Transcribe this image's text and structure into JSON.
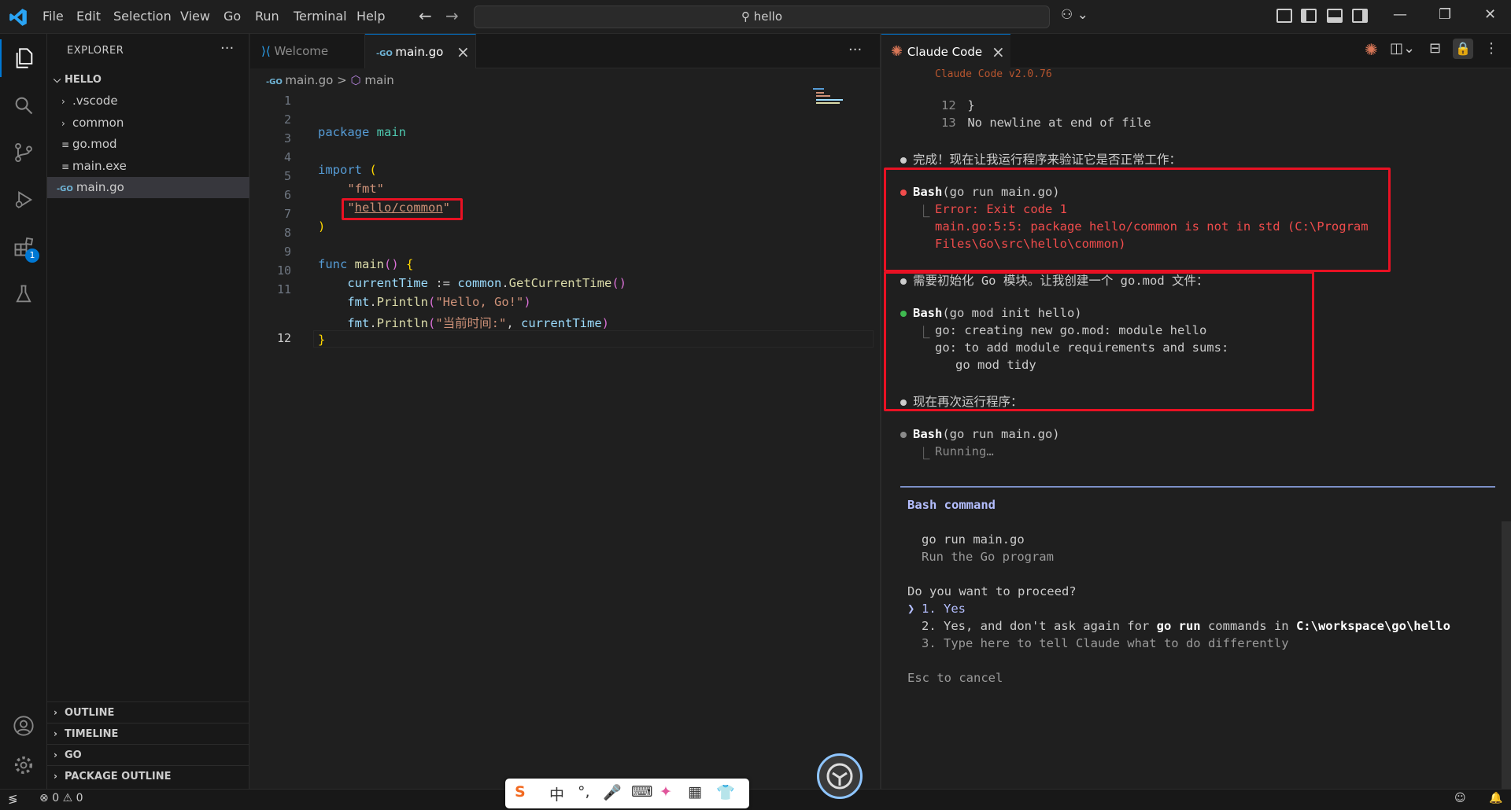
{
  "menu": {
    "items": [
      "File",
      "Edit",
      "Selection",
      "View",
      "Go",
      "Run",
      "Terminal",
      "Help"
    ]
  },
  "command_center": {
    "text": "hello",
    "icon": "search-icon"
  },
  "activity_bar": {
    "items": [
      {
        "name": "explorer",
        "icon": "files-icon",
        "active": true
      },
      {
        "name": "search",
        "icon": "search-icon"
      },
      {
        "name": "source-control",
        "icon": "source-control-icon"
      },
      {
        "name": "run-debug",
        "icon": "debug-icon"
      },
      {
        "name": "extensions",
        "icon": "extensions-icon",
        "badge": "1"
      },
      {
        "name": "testing",
        "icon": "flask-icon"
      }
    ],
    "bottom": [
      {
        "name": "accounts",
        "icon": "account-icon"
      },
      {
        "name": "manage",
        "icon": "gear-icon"
      }
    ]
  },
  "sidebar": {
    "title": "EXPLORER",
    "more": "···",
    "root": "HELLO",
    "items": [
      {
        "label": ".vscode",
        "type": "folder"
      },
      {
        "label": "common",
        "type": "folder"
      },
      {
        "label": "go.mod",
        "type": "file",
        "icon": "≡"
      },
      {
        "label": "main.exe",
        "type": "file",
        "icon": "≡"
      },
      {
        "label": "main.go",
        "type": "file",
        "icon": "-GO",
        "selected": true
      }
    ],
    "sections": [
      "OUTLINE",
      "TIMELINE",
      "GO",
      "PACKAGE OUTLINE"
    ]
  },
  "editor": {
    "tabs": [
      {
        "label": "Welcome",
        "active": false
      },
      {
        "label": "main.go",
        "active": true,
        "close": "×"
      }
    ],
    "more": "···",
    "breadcrumb": {
      "file": "main.go",
      "sep": ">",
      "symbol": "main"
    },
    "line_numbers": [
      "1",
      "2",
      "3",
      "4",
      "5",
      "6",
      "7",
      "8",
      "9",
      "10",
      "11",
      "12"
    ],
    "code": {
      "l1_kw": "package",
      "l1_name": "main",
      "l3_kw": "import",
      "l3_paren": "(",
      "l4": "\"fmt\"",
      "l5_q1": "\"",
      "l5_path": "hello/common",
      "l5_q2": "\"",
      "l6": ")",
      "l8_kw": "func",
      "l8_fn": "main",
      "l8_paren": "()",
      "l8_brace": "{",
      "l9_var": "currentTime",
      "l9_op": " := ",
      "l9_pkg": "common",
      "l9_dot": ".",
      "l9_fn": "GetCurrentTime",
      "l9_paren": "()",
      "l10_pkg": "fmt",
      "l10_dot": ".",
      "l10_fn": "Println",
      "l10_open": "(",
      "l10_str": "\"Hello, Go!\"",
      "l10_close": ")",
      "l11_pkg": "fmt",
      "l11_dot": ".",
      "l11_fn": "Println",
      "l11_open": "(",
      "l11_str": "\"当前时间:\"",
      "l11_comma": ", ",
      "l11_var": "currentTime",
      "l11_close": ")",
      "l12": "}"
    }
  },
  "claude": {
    "tab_label": "Claude Code",
    "tab_close": "×",
    "header_partial": "Claude Code v2.0.76",
    "lines": {
      "ln12": "12",
      "ln12_text": " }",
      "ln13": "13",
      "ln13_text": " No newline at end of file",
      "msg1": "完成！现在让我运行程序来验证它是否正常工作：",
      "bash1_label": "Bash",
      "bash1_cmd": "(go run main.go)",
      "bash1_err1": "Error: Exit code 1",
      "bash1_err2": "main.go:5:5: package hello/common is not in std (C:\\Program",
      "bash1_err3": "Files\\Go\\src\\hello\\common)",
      "msg2": "需要初始化 Go 模块。让我创建一个 go.mod 文件：",
      "bash2_label": "Bash",
      "bash2_cmd": "(go mod init hello)",
      "bash2_out1": "go: creating new go.mod: module hello",
      "bash2_out2": "go: to add module requirements and sums:",
      "bash2_out3": "go mod tidy",
      "msg3": "现在再次运行程序：",
      "bash3_label": "Bash",
      "bash3_cmd": "(go run main.go)",
      "bash3_status": "Running…",
      "prompt_title": "Bash command",
      "prompt_cmd": "go run main.go",
      "prompt_desc": "Run the Go program",
      "question": "Do you want to proceed?",
      "opt1": "1. Yes",
      "opt2_a": "2. Yes, and don't ask again for ",
      "opt2_b": "go run",
      "opt2_c": " commands in ",
      "opt2_d": "C:\\workspace\\go\\hello",
      "opt3": "3. Type here to tell Claude what to do differently",
      "cancel": "Esc to cancel",
      "pointer": "❯",
      "tree_mark": "⎿"
    }
  },
  "statusbar": {
    "errors": "0",
    "warnings": "0"
  },
  "ime": {
    "items": [
      "S",
      "中",
      "°,",
      "🎤",
      "⌨",
      "✦",
      "▦",
      "👕"
    ]
  },
  "colors": {
    "accent": "#0078d4",
    "error": "#f14c4c",
    "success": "#3fb950",
    "highlight_box": "#e81123",
    "claude_orange": "#d97757"
  }
}
